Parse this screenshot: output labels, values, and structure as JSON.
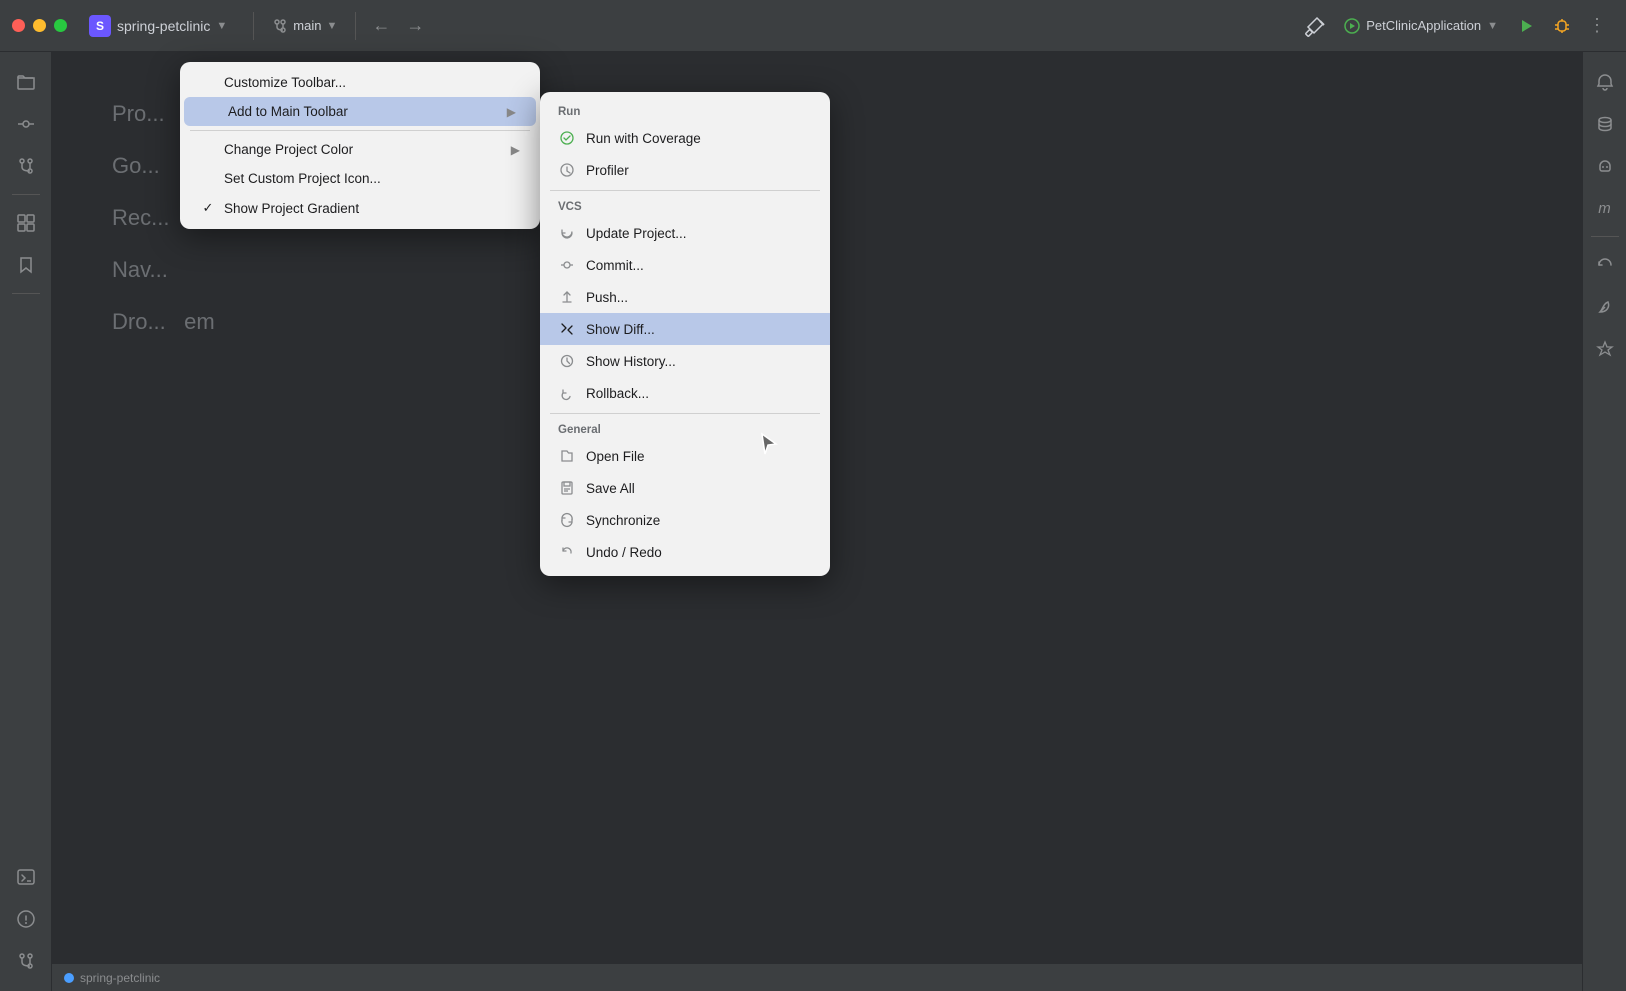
{
  "titlebar": {
    "project_name": "spring-petclinic",
    "project_initial": "S",
    "branch_name": "main",
    "run_config": "PetClinicApplication",
    "nav_back": "←",
    "nav_forward": "→"
  },
  "context_menu_1": {
    "items": [
      {
        "id": "customize-toolbar",
        "label": "Customize Toolbar...",
        "check": "",
        "has_arrow": false
      },
      {
        "id": "add-to-main-toolbar",
        "label": "Add to Main Toolbar",
        "check": "",
        "has_arrow": true,
        "highlighted": true
      },
      {
        "id": "change-project-color",
        "label": "Change Project Color",
        "check": "",
        "has_arrow": true
      },
      {
        "id": "set-custom-icon",
        "label": "Set Custom Project Icon...",
        "check": "",
        "has_arrow": false
      },
      {
        "id": "show-gradient",
        "label": "Show Project Gradient",
        "check": "✓",
        "has_arrow": false
      }
    ]
  },
  "context_menu_2": {
    "sections": [
      {
        "id": "run-section",
        "label": "Run",
        "items": [
          {
            "id": "run-coverage",
            "label": "Run with Coverage",
            "icon": "coverage"
          },
          {
            "id": "profiler",
            "label": "Profiler",
            "icon": "profiler"
          }
        ]
      },
      {
        "id": "vcs-section",
        "label": "VCS",
        "items": [
          {
            "id": "update-project",
            "label": "Update Project...",
            "icon": "update"
          },
          {
            "id": "commit",
            "label": "Commit...",
            "icon": "commit"
          },
          {
            "id": "push",
            "label": "Push...",
            "icon": "push"
          },
          {
            "id": "show-diff",
            "label": "Show Diff...",
            "icon": "diff",
            "highlighted": true
          },
          {
            "id": "show-history",
            "label": "Show History...",
            "icon": "history"
          },
          {
            "id": "rollback",
            "label": "Rollback...",
            "icon": "rollback"
          }
        ]
      },
      {
        "id": "general-section",
        "label": "General",
        "items": [
          {
            "id": "open-file",
            "label": "Open File",
            "icon": "file"
          },
          {
            "id": "save-all",
            "label": "Save All",
            "icon": "save"
          },
          {
            "id": "synchronize",
            "label": "Synchronize",
            "icon": "sync"
          },
          {
            "id": "undo-redo",
            "label": "Undo / Redo",
            "icon": "undo"
          }
        ]
      }
    ]
  },
  "sidebar_left": {
    "icons": [
      "folder",
      "git-commit",
      "git-branch",
      "apps",
      "bookmark",
      "database-icon",
      "terminal",
      "warning"
    ]
  },
  "sidebar_right": {
    "icons": [
      "bell",
      "database-right",
      "bot",
      "m-letter",
      "refresh-right",
      "leaf",
      "star-right",
      "warning-right"
    ]
  },
  "content": {
    "lines": [
      "Pro...",
      "Go...",
      "Rec...",
      "Nav...",
      "Dro...  em"
    ]
  },
  "status_bar": {
    "project_name": "spring-petclinic"
  }
}
